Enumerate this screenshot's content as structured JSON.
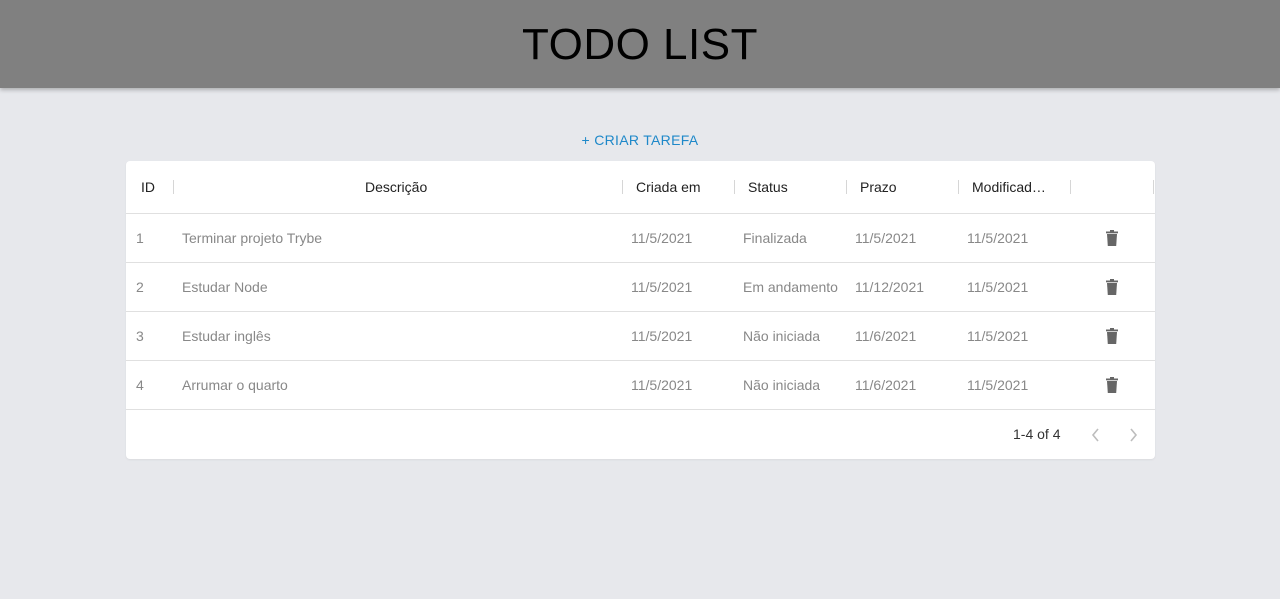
{
  "header": {
    "title": "TODO LIST"
  },
  "actions": {
    "create_label": "+ CRIAR TAREFA"
  },
  "table": {
    "columns": [
      "ID",
      "Descrição",
      "Criada em",
      "Status",
      "Prazo",
      "Modificad…"
    ],
    "rows": [
      {
        "id": "1",
        "description": "Terminar projeto Trybe",
        "created": "11/5/2021",
        "status": "Finalizada",
        "deadline": "11/5/2021",
        "modified": "11/5/2021"
      },
      {
        "id": "2",
        "description": "Estudar Node",
        "created": "11/5/2021",
        "status": "Em andamento",
        "deadline": "11/12/2021",
        "modified": "11/5/2021"
      },
      {
        "id": "3",
        "description": "Estudar inglês",
        "created": "11/5/2021",
        "status": "Não iniciada",
        "deadline": "11/6/2021",
        "modified": "11/5/2021"
      },
      {
        "id": "4",
        "description": "Arrumar o quarto",
        "created": "11/5/2021",
        "status": "Não iniciada",
        "deadline": "11/6/2021",
        "modified": "11/5/2021"
      }
    ],
    "row_action_icon": "trash-icon"
  },
  "pagination": {
    "range_text": "1-4 of 4",
    "prev_icon": "chevron-left-icon",
    "next_icon": "chevron-right-icon"
  },
  "colors": {
    "accent": "#1e88c9",
    "header_bg": "#808080",
    "page_bg": "#e7e8ec"
  }
}
